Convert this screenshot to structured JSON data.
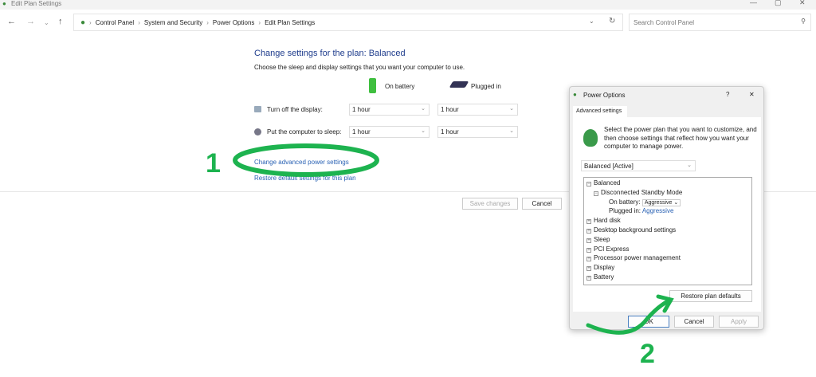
{
  "window": {
    "title": "Edit Plan Settings"
  },
  "nav": {
    "breadcrumb": [
      "Control Panel",
      "System and Security",
      "Power Options",
      "Edit Plan Settings"
    ],
    "search_placeholder": "Search Control Panel"
  },
  "main": {
    "heading": "Change settings for the plan: Balanced",
    "subtitle": "Choose the sleep and display settings that you want your computer to use.",
    "col_battery": "On battery",
    "col_plugged": "Plugged in",
    "rows": [
      {
        "label": "Turn off the display:",
        "battery": "1 hour",
        "plugged": "1 hour"
      },
      {
        "label": "Put the computer to sleep:",
        "battery": "1 hour",
        "plugged": "1 hour"
      }
    ],
    "link_advanced": "Change advanced power settings",
    "link_restore": "Restore default settings for this plan",
    "save": "Save changes",
    "cancel": "Cancel"
  },
  "dialog": {
    "title": "Power Options",
    "help": "?",
    "close": "✕",
    "tab": "Advanced settings",
    "description": "Select the power plan that you want to customize, and then choose settings that reflect how you want your computer to manage power.",
    "plan": "Balanced [Active]",
    "tree": {
      "root": "Balanced",
      "standby": "Disconnected Standby Mode",
      "on_battery_label": "On battery:",
      "on_battery_value": "Aggressive",
      "plugged_label": "Plugged in:",
      "plugged_value": "Aggressive",
      "items": [
        "Hard disk",
        "Desktop background settings",
        "Sleep",
        "PCI Express",
        "Processor power management",
        "Display",
        "Battery"
      ]
    },
    "restore": "Restore plan defaults",
    "ok": "OK",
    "cancel": "Cancel",
    "apply": "Apply"
  },
  "annotations": {
    "step1": "1",
    "step2": "2",
    "color": "#1db34f"
  }
}
